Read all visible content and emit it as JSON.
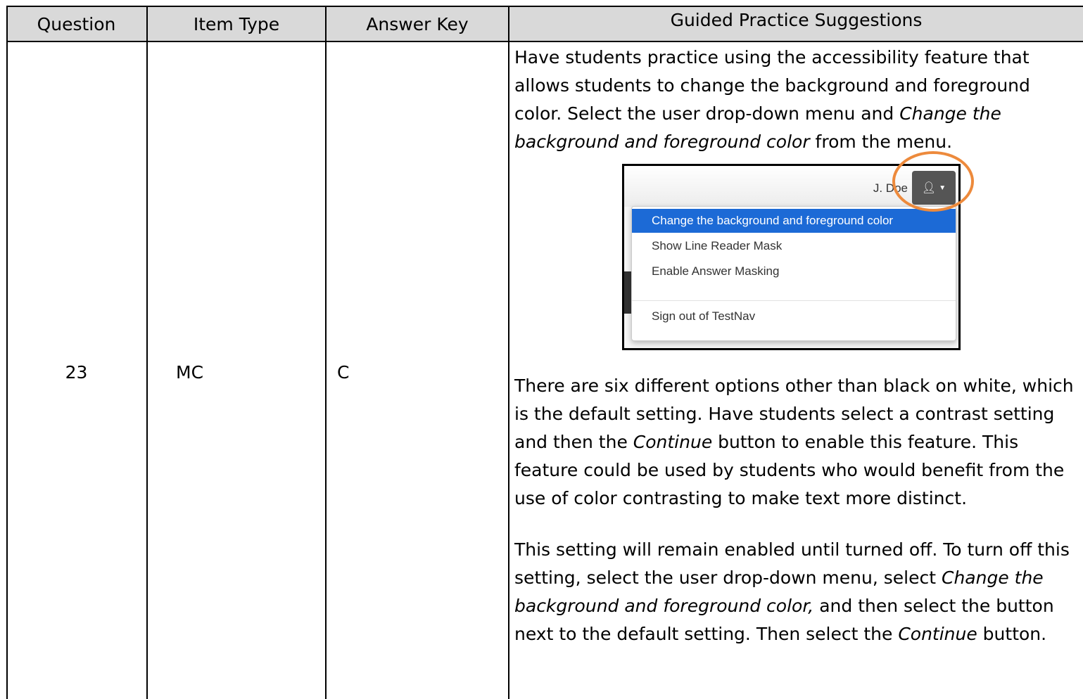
{
  "headers": {
    "question": "Question",
    "item_type": "Item Type",
    "answer_key": "Answer Key",
    "suggestions": "Guided Practice Suggestions"
  },
  "row": {
    "question": "23",
    "item_type": "MC",
    "answer_key": "C"
  },
  "suggestion_p1": {
    "a": "Have students practice using the accessibility feature that allows students to change the background and foreground color.  Select the user drop-down menu and ",
    "a_em": "Change the background and foreground color",
    "a_end": " from the menu."
  },
  "screenshot": {
    "user_name": "J. Doe",
    "menu_items": [
      "Change the background and foreground color",
      "Show Line Reader Mask",
      "Enable Answer Masking",
      "Sign out of TestNav"
    ]
  },
  "suggestion_p2": {
    "a": "There are six different options other than black on white, which is the default setting.  Have students select a contrast setting and then the ",
    "a_em": "Continue",
    "a_end": " button to enable this feature.  This feature could be used by students who would benefit from the use of color contrasting to make text more distinct."
  },
  "suggestion_p3": {
    "a": "This setting will remain enabled until turned off.  To turn off this setting, select the user drop-down menu, select ",
    "a_em": "Change the background and foreground color,",
    "a_mid": " and then select the button next to the default setting.  Then select the ",
    "a_em2": "Continue",
    "a_end": " button."
  },
  "colors": {
    "header_bg": "#d9d9d9",
    "highlight_circle": "#ed8a3c",
    "menu_selected": "#1c6ad6"
  }
}
